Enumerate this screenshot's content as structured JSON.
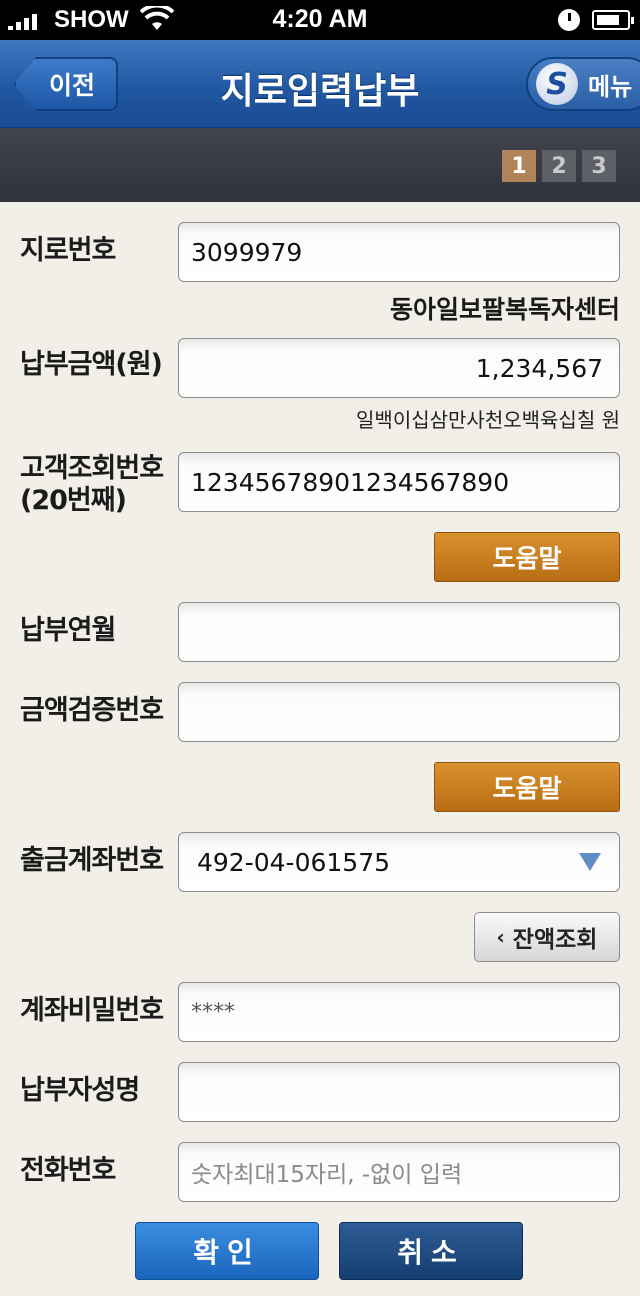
{
  "status_bar": {
    "carrier": "SHOW",
    "time": "4:20 AM"
  },
  "nav": {
    "back_label": "이전",
    "title": "지로입력납부",
    "menu_label": "메뉴"
  },
  "steps": [
    "1",
    "2",
    "3"
  ],
  "active_step": 1,
  "form": {
    "giro_number": {
      "label": "지로번호",
      "value": "3099979",
      "recipient": "동아일보팔복독자센터"
    },
    "amount": {
      "label": "납부금액(원)",
      "value": "1,234,567",
      "in_words": "일백이십삼만사천오백육십칠 원"
    },
    "customer_ref": {
      "label_line1": "고객조회번호",
      "label_line2": "(20번째)",
      "value": "12345678901234567890"
    },
    "help_label": "도움말",
    "pay_month": {
      "label": "납부연월",
      "value": ""
    },
    "amount_verify": {
      "label": "금액검증번호",
      "value": ""
    },
    "account": {
      "label": "출금계좌번호",
      "value": "492-04-061575"
    },
    "balance_label": "잔액조회",
    "password": {
      "label": "계좌비밀번호",
      "value": "****"
    },
    "payer_name": {
      "label": "납부자성명",
      "value": ""
    },
    "phone": {
      "label": "전화번호",
      "placeholder": "숫자최대15자리, -없이 입력"
    }
  },
  "buttons": {
    "confirm": "확인",
    "cancel": "취소"
  },
  "colors": {
    "nav_blue": "#2258a3",
    "help_orange": "#c97d1f",
    "active_step": "#b08359"
  }
}
